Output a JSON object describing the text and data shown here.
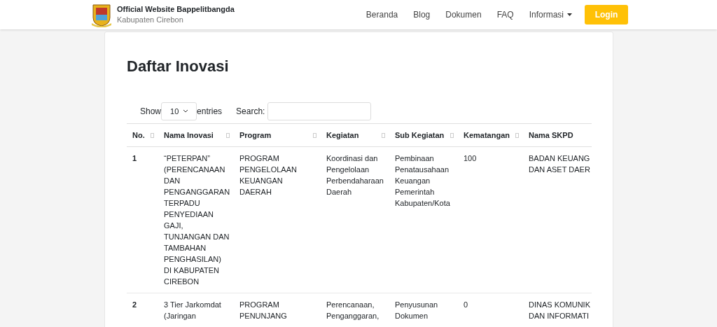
{
  "header": {
    "title": "Official Website Bappelitbangda",
    "subtitle": "Kabupaten Cirebon",
    "nav": [
      {
        "label": "Beranda",
        "dropdown": false
      },
      {
        "label": "Blog",
        "dropdown": false
      },
      {
        "label": "Dokumen",
        "dropdown": false
      },
      {
        "label": "FAQ",
        "dropdown": false
      },
      {
        "label": "Informasi",
        "dropdown": true
      }
    ],
    "login": "Login"
  },
  "page_title": "Daftar Inovasi",
  "controls": {
    "show_label": "Show",
    "entries_value": "10",
    "entries_label": "entries",
    "search_label": "Search:"
  },
  "table": {
    "columns": [
      {
        "label": "No.",
        "sortable": true
      },
      {
        "label": "Nama Inovasi",
        "sortable": true
      },
      {
        "label": "Program",
        "sortable": true
      },
      {
        "label": "Kegiatan",
        "sortable": true
      },
      {
        "label": "Sub Kegiatan",
        "sortable": true
      },
      {
        "label": "Kematangan",
        "sortable": true
      },
      {
        "label": "Nama SKPD",
        "sortable": false
      }
    ],
    "rows": [
      {
        "cells": [
          "1",
          "“PETERPAN”\n(PERENCANAAN\nDAN\nPENGANGGARAN\nTERPADU\nPENYEDIAAN\nGAJI,\nTUNJANGAN DAN\nTAMBAHAN\nPENGHASILAN)\nDI KABUPATEN\nCIREBON",
          "PROGRAM\nPENGELOLAAN\nKEUANGAN\nDAERAH",
          "Koordinasi dan\nPengelolaan\nPerbendaharaan\nDaerah",
          "Pembinaan\nPenatausahaan\nKeuangan\nPemerintah\nKabupaten/Kota",
          "100",
          "BADAN KEUANG\nDAN ASET DAER"
        ]
      },
      {
        "cells": [
          "2",
          "3 Tier Jarkomdat\n(Jaringan",
          "PROGRAM\nPENUNJANG",
          "Perencanaan,\nPenganggaran,",
          "Penyusunan\nDokumen",
          "0",
          "DINAS KOMUNIK\nDAN INFORMATI"
        ]
      }
    ]
  }
}
